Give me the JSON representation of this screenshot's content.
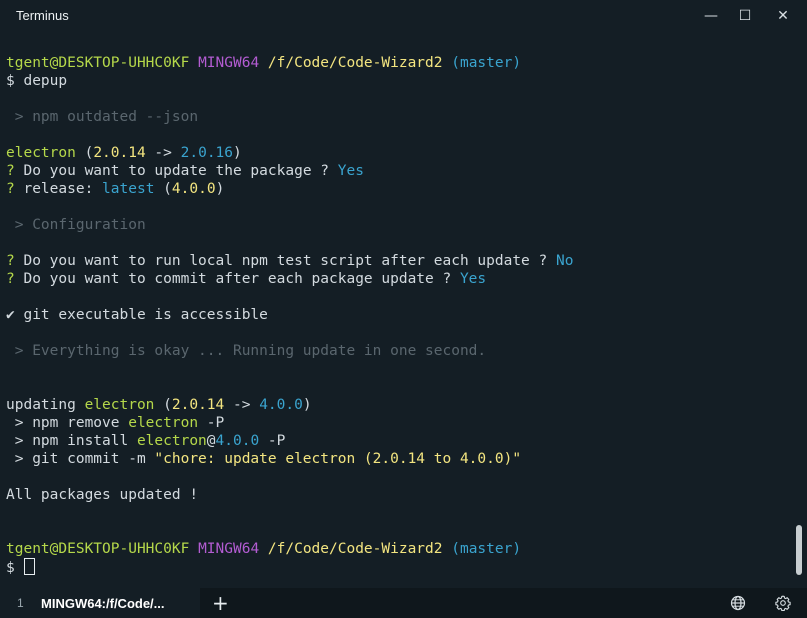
{
  "window": {
    "title": "Terminus",
    "min_glyph": "—",
    "max_glyph": "☐",
    "close_glyph": "✕"
  },
  "terminal": {
    "lines": [
      {
        "spans": [
          {
            "text": "tgent@DESKTOP-UHHC0KF ",
            "color": "green"
          },
          {
            "text": "MINGW64 ",
            "color": "purple"
          },
          {
            "text": "/f/Code/Code-Wizard2 ",
            "color": "yellow"
          },
          {
            "text": "(master)",
            "color": "cyan"
          }
        ]
      },
      {
        "spans": [
          {
            "text": "$ depup",
            "color": "white"
          }
        ]
      },
      {
        "spans": []
      },
      {
        "spans": [
          {
            "text": " > npm outdated --json",
            "color": "dim"
          }
        ]
      },
      {
        "spans": []
      },
      {
        "spans": [
          {
            "text": "electron",
            "color": "green"
          },
          {
            "text": " (",
            "color": "white"
          },
          {
            "text": "2.0.14",
            "color": "yellow"
          },
          {
            "text": " -> ",
            "color": "white"
          },
          {
            "text": "2.0.16",
            "color": "cyan"
          },
          {
            "text": ")",
            "color": "white"
          }
        ]
      },
      {
        "spans": [
          {
            "text": "?",
            "color": "green"
          },
          {
            "text": " Do you want to update the package ? ",
            "color": "white"
          },
          {
            "text": "Yes",
            "color": "cyan"
          }
        ]
      },
      {
        "spans": [
          {
            "text": "?",
            "color": "green"
          },
          {
            "text": " release: ",
            "color": "white"
          },
          {
            "text": "latest",
            "color": "cyan"
          },
          {
            "text": " (",
            "color": "white"
          },
          {
            "text": "4.0.0",
            "color": "yellow"
          },
          {
            "text": ")",
            "color": "white"
          }
        ]
      },
      {
        "spans": []
      },
      {
        "spans": [
          {
            "text": " > Configuration",
            "color": "dim"
          }
        ]
      },
      {
        "spans": []
      },
      {
        "spans": [
          {
            "text": "?",
            "color": "green"
          },
          {
            "text": " Do you want to run local npm test script after each update ? ",
            "color": "white"
          },
          {
            "text": "No",
            "color": "cyan"
          }
        ]
      },
      {
        "spans": [
          {
            "text": "?",
            "color": "green"
          },
          {
            "text": " Do you want to commit after each package update ? ",
            "color": "white"
          },
          {
            "text": "Yes",
            "color": "cyan"
          }
        ]
      },
      {
        "spans": []
      },
      {
        "spans": [
          {
            "text": "✔ git executable is accessible",
            "color": "white"
          }
        ]
      },
      {
        "spans": []
      },
      {
        "spans": [
          {
            "text": " > Everything is okay ... Running update in one second.",
            "color": "dim"
          }
        ]
      },
      {
        "spans": []
      },
      {
        "spans": []
      },
      {
        "spans": [
          {
            "text": "updating ",
            "color": "white"
          },
          {
            "text": "electron",
            "color": "green"
          },
          {
            "text": " (",
            "color": "white"
          },
          {
            "text": "2.0.14",
            "color": "yellow"
          },
          {
            "text": " -> ",
            "color": "white"
          },
          {
            "text": "4.0.0",
            "color": "cyan"
          },
          {
            "text": ")",
            "color": "white"
          }
        ]
      },
      {
        "spans": [
          {
            "text": " > npm remove ",
            "color": "white"
          },
          {
            "text": "electron",
            "color": "green"
          },
          {
            "text": " -P",
            "color": "white"
          }
        ]
      },
      {
        "spans": [
          {
            "text": " > npm install ",
            "color": "white"
          },
          {
            "text": "electron",
            "color": "green"
          },
          {
            "text": "@",
            "color": "white"
          },
          {
            "text": "4.0.0",
            "color": "cyan"
          },
          {
            "text": " -P",
            "color": "white"
          }
        ]
      },
      {
        "spans": [
          {
            "text": " > git commit -m ",
            "color": "white"
          },
          {
            "text": "\"chore: update electron (2.0.14 to 4.0.0)\"",
            "color": "yellow"
          }
        ]
      },
      {
        "spans": []
      },
      {
        "spans": [
          {
            "text": "All packages updated !",
            "color": "white"
          }
        ]
      },
      {
        "spans": []
      },
      {
        "spans": []
      },
      {
        "spans": [
          {
            "text": "tgent@DESKTOP-UHHC0KF ",
            "color": "green"
          },
          {
            "text": "MINGW64 ",
            "color": "purple"
          },
          {
            "text": "/f/Code/Code-Wizard2 ",
            "color": "yellow"
          },
          {
            "text": "(master)",
            "color": "cyan"
          }
        ]
      }
    ],
    "prompt_symbol": "$ "
  },
  "tabs": [
    {
      "index": "1",
      "title": "MINGW64:/f/Code/..."
    }
  ],
  "tabbar": {
    "add_glyph": "+",
    "icons": [
      "globe-icon",
      "settings-gear-icon"
    ]
  },
  "colors": {
    "background": "#141e25",
    "green": "#b5d84a",
    "purple": "#b35cd2",
    "yellow": "#f3e580",
    "cyan": "#3aa4cf",
    "dim": "#5a666e",
    "white": "#d3dadf"
  }
}
